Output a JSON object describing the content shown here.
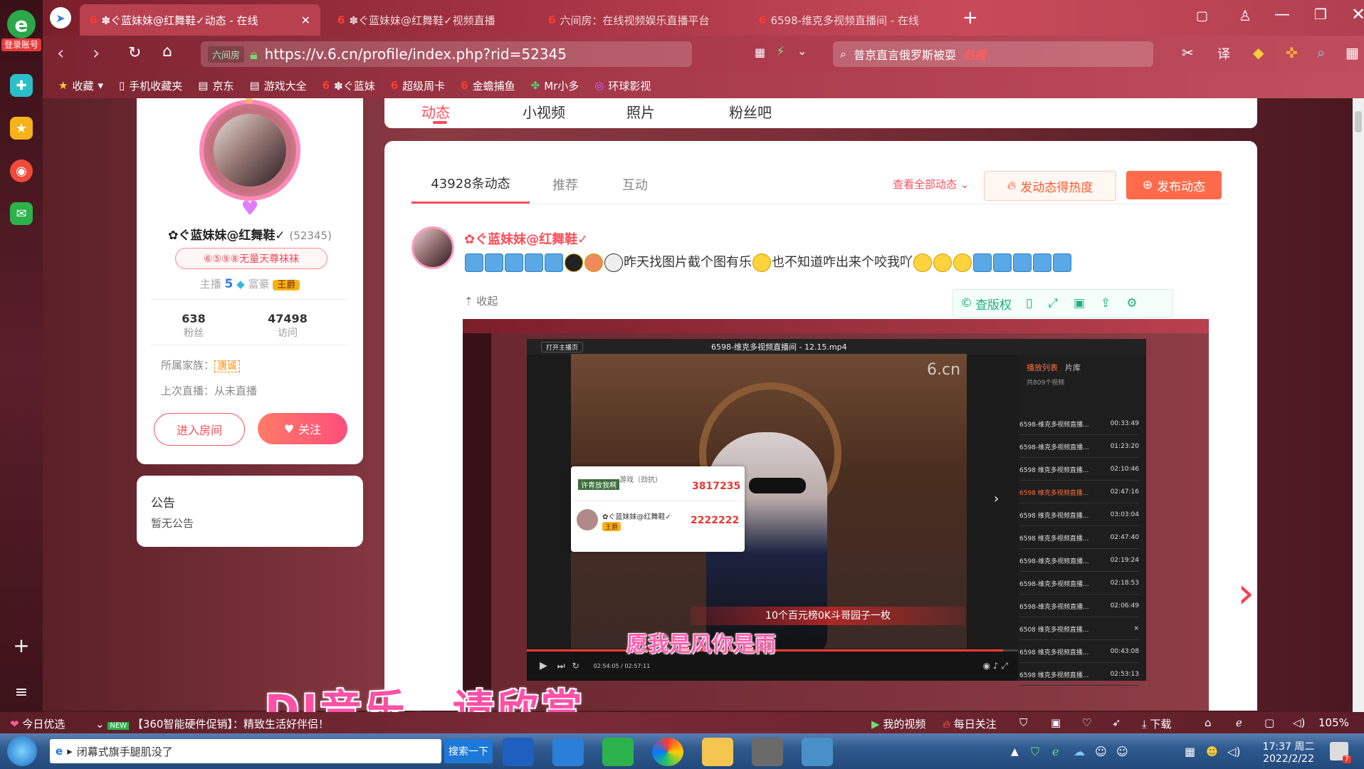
{
  "browser": {
    "login_label": "登录账号",
    "tabs": [
      {
        "title": "✽ぐ蓝妹妹@红舞鞋✓动态 - 在线"
      },
      {
        "title": "✽ぐ蓝妹妹@红舞鞋✓视频直播"
      },
      {
        "title": "六间房：在线视频娱乐直播平台"
      },
      {
        "title": "6598-维克多视频直播间 - 在线"
      }
    ],
    "url": "https://v.6.cn/profile/index.php?rid=52345",
    "secure_label": "六间房",
    "search_text": "普京直言俄罗斯被耍",
    "search_badge": "热搜",
    "bookmarks": [
      "收藏",
      "手机收藏夹",
      "京东",
      "游戏大全",
      "✽ぐ蓝妹",
      "超级周卡",
      "金蟾捕鱼",
      "Mr小多",
      "环球影视"
    ]
  },
  "profile": {
    "name": "✿ぐ蓝妹妹@红舞鞋✓",
    "rid": "(52345)",
    "badge": "⑥⑤⑨⑧无量天尊袜袜",
    "level_label": "主播",
    "level_value": "5",
    "rich_label": "富豪",
    "rich_badge": "王爵",
    "fans_count": "638",
    "fans_label": "粉丝",
    "visits_count": "47498",
    "visits_label": "访问",
    "family_label": "所属家族：",
    "family_value": "唐诚",
    "last_live": "上次直播：从未直播",
    "enter_room": "进入房间",
    "follow": "关注"
  },
  "notice": {
    "title": "公告",
    "body": "暂无公告"
  },
  "main_tabs": [
    "动态",
    "小视频",
    "照片",
    "粉丝吧"
  ],
  "feed": {
    "tabs": [
      "43928条动态",
      "推荐",
      "互动"
    ],
    "view_all": "查看全部动态",
    "hot_button": "发动态得热度",
    "post_button": "发布动态",
    "post": {
      "author": "✿ぐ蓝妹妹@红舞鞋✓",
      "text_mid": "昨天找图片截个图有乐",
      "text_mid2": "也不知道咋出来个咬我吖",
      "collapse": "收起",
      "copyright": "查版权"
    }
  },
  "video": {
    "window_title": "6598-维克多视频直播间 - 12.15.mp4",
    "top_left": "打开主播页",
    "gift1_label": "游戏（劲抗）",
    "gift1_sub": "许青放我啊",
    "gift1_value": "3817235",
    "gift2_name": "✿ぐ蓝妹妹@红舞鞋✓",
    "gift2_badge": "王爵",
    "gift2_value": "2222222",
    "banner": "10个百元榜0K斗哥园子一枚",
    "lyric": "愿我是风你是雨",
    "watermark": "6.cn",
    "playlist_tabs": [
      "播放列表",
      "片库"
    ],
    "playlist_count": "共809个视频",
    "playlist": [
      {
        "title": "6598-维克多视频直播...",
        "time": "00:33:49"
      },
      {
        "title": "6598-维克多视频直播...",
        "time": "01:23:20"
      },
      {
        "title": "6598 维克多视频直播...",
        "time": "02:10:46"
      },
      {
        "title": "6598 维克多视频直播...",
        "time": "02:47:16"
      },
      {
        "title": "6598 维克多视频直播...",
        "time": "03:03:04"
      },
      {
        "title": "6598 维克多视频直播...",
        "time": "02:47:40"
      },
      {
        "title": "6598-维克多视频直播...",
        "time": "02:19:24"
      },
      {
        "title": "6598-维克多视频直播...",
        "time": "02:18:53"
      },
      {
        "title": "6598-维克多视频直播...",
        "time": "02:06:49"
      },
      {
        "title": "6508 维克多视频直播...",
        "time": "×"
      },
      {
        "title": "6598 维克多视频直播...",
        "time": "00:43:08"
      },
      {
        "title": "6598 维克多视频直播...",
        "time": "02:53:13"
      }
    ],
    "time_readout": "02:54:05 / 02:57:11"
  },
  "caption": "DJ音乐，请欣赏",
  "statusbar": {
    "left_label": "今日优选",
    "news": "【360智能硬件促销】：精致生活好伴侣！",
    "my_video": "我的视频",
    "daily": "每日关注",
    "download": "下载",
    "zoom": "105%"
  },
  "taskbar": {
    "ie_label": "闭幕式旗手腿肌没了",
    "search_btn": "搜索一下",
    "clock_time": "17:37 周二",
    "clock_date": "2022/2/22",
    "badge_count": "7"
  },
  "colors": {
    "accent": "#ff4d58",
    "brand": "#e93f4e"
  }
}
